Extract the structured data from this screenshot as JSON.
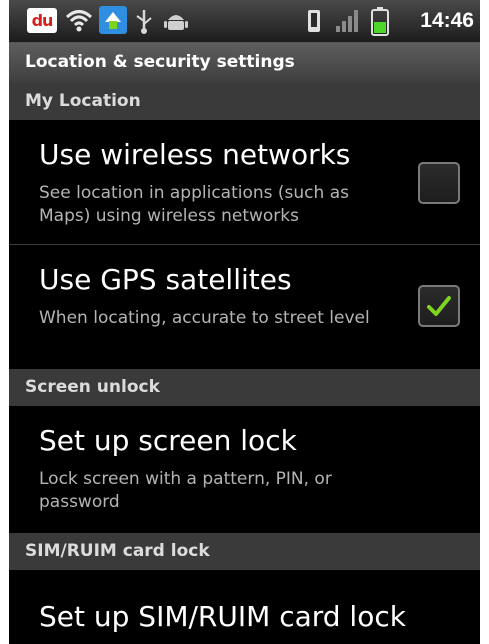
{
  "status_bar": {
    "app_badge": "du",
    "time": "14:46",
    "icons": [
      "du-icon",
      "wifi-icon",
      "sync-icon",
      "usb-icon",
      "android-debug-icon",
      "vibrate-icon",
      "signal-icon",
      "battery-icon"
    ]
  },
  "title": "Location & security settings",
  "sections": {
    "my_location": {
      "header": "My Location",
      "wireless": {
        "title": "Use wireless networks",
        "summary": "See location in applications (such as Maps) using wireless networks",
        "checked": false
      },
      "gps": {
        "title": "Use GPS satellites",
        "summary": "When locating, accurate to street level",
        "checked": true
      }
    },
    "screen_unlock": {
      "header": "Screen unlock",
      "setup": {
        "title": "Set up screen lock",
        "summary": "Lock screen with a pattern, PIN, or password"
      }
    },
    "sim_lock": {
      "header": "SIM/RUIM card lock",
      "setup": {
        "title": "Set up SIM/RUIM card lock"
      }
    }
  },
  "colors": {
    "background": "#000000",
    "category_bg": "#3a3a3a",
    "checkmark": "#7ed321",
    "summary_text": "#b4b4b4"
  }
}
